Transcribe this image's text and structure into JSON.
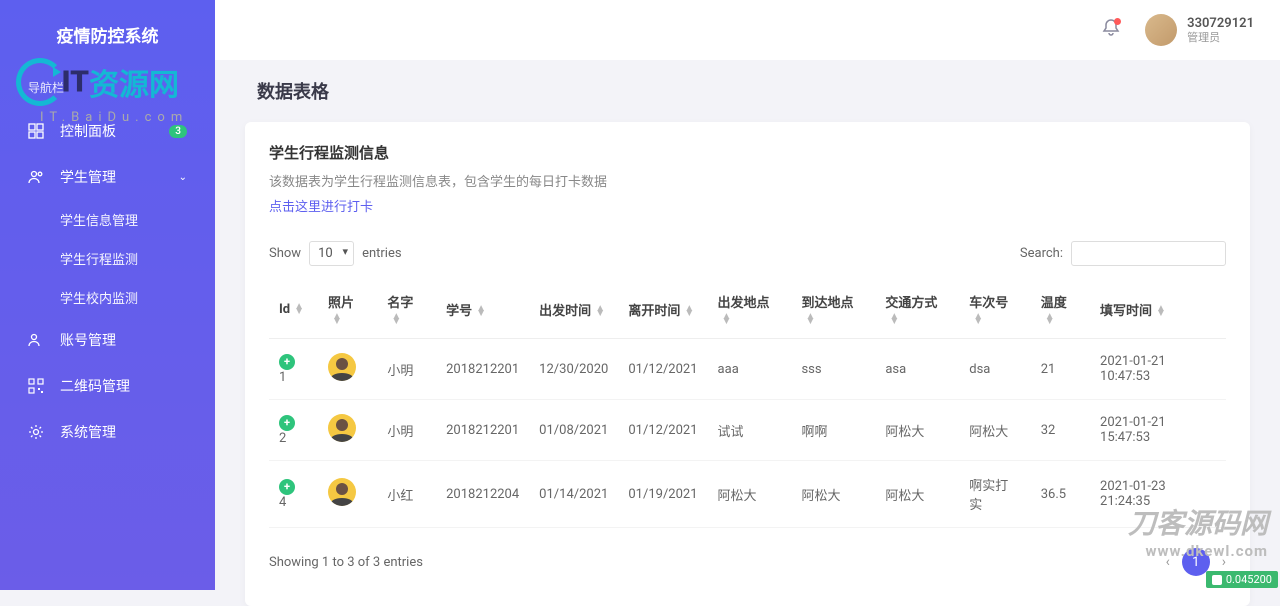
{
  "brand": "疫情防控系统",
  "nav_label": "导航栏",
  "nav": {
    "dashboard": {
      "label": "控制面板",
      "badge": "3"
    },
    "student": {
      "label": "学生管理",
      "children": [
        {
          "label": "学生信息管理"
        },
        {
          "label": "学生行程监测"
        },
        {
          "label": "学生校内监测"
        }
      ]
    },
    "account": {
      "label": "账号管理"
    },
    "qrcode": {
      "label": "二维码管理"
    },
    "system": {
      "label": "系统管理"
    }
  },
  "topbar": {
    "user_id": "330729121",
    "user_role": "管理员"
  },
  "page": {
    "title": "数据表格",
    "card_title": "学生行程监测信息",
    "card_desc": "该数据表为学生行程监测信息表，包含学生的每日打卡数据",
    "card_link": "点击这里进行打卡",
    "show_label": "Show",
    "entries_label": "entries",
    "entries_value": "10",
    "search_label": "Search:",
    "columns": [
      "Id",
      "照片",
      "名字",
      "学号",
      "出发时间",
      "离开时间",
      "出发地点",
      "到达地点",
      "交通方式",
      "车次号",
      "温度",
      "填写时间"
    ],
    "rows": [
      {
        "id": "1",
        "name": "小明",
        "sno": "2018212201",
        "depart": "12/30/2020",
        "leave": "01/12/2021",
        "from": "aaa",
        "to": "sss",
        "transport": "asa",
        "trip": "dsa",
        "temp": "21",
        "fill": "2021-01-21 10:47:53"
      },
      {
        "id": "2",
        "name": "小明",
        "sno": "2018212201",
        "depart": "01/08/2021",
        "leave": "01/12/2021",
        "from": "试试",
        "to": "啊啊",
        "transport": "阿松大",
        "trip": "阿松大",
        "temp": "32",
        "fill": "2021-01-21 15:47:53"
      },
      {
        "id": "4",
        "name": "小红",
        "sno": "2018212204",
        "depart": "01/14/2021",
        "leave": "01/19/2021",
        "from": "阿松大",
        "to": "阿松大",
        "transport": "阿松大",
        "trip": "啊实打实",
        "temp": "36.5",
        "fill": "2021-01-23 21:24:35"
      }
    ],
    "info_text": "Showing 1 to 3 of 3 entries",
    "page_current": "1"
  },
  "watermark": {
    "main1": "IT",
    "main2": "资源网",
    "sub": "IT.BaiDu.com",
    "br1": "刀客源码网",
    "br2": "www.dkewl.com"
  },
  "debug": "0.045200"
}
